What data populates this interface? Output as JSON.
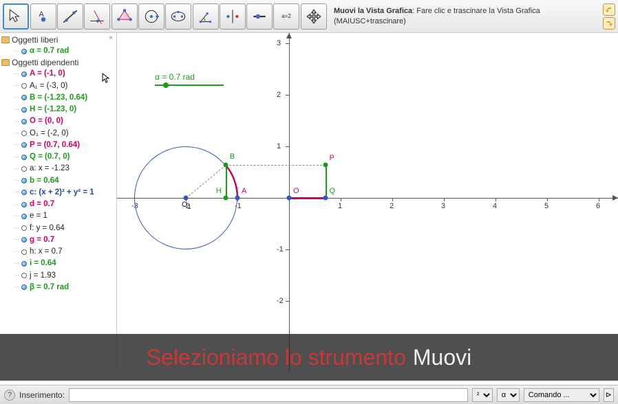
{
  "toolbar": {
    "hint_title": "Muovi la Vista Grafica",
    "hint_body": ": Fare clic e trascinare la Vista Grafica (MAIUSC+trascinare)",
    "tools": [
      "move",
      "point",
      "line",
      "perpendicular",
      "polygon",
      "circle",
      "ellipse",
      "angle",
      "reflect",
      "slider",
      "text",
      "move-view"
    ]
  },
  "sidebar": {
    "free_label": "Oggetti liberi",
    "dep_label": "Oggetti dipendenti",
    "free": [
      {
        "label": "α = 0.7 rad",
        "filled": true,
        "color": "#1a9c1a"
      }
    ],
    "dep": [
      {
        "label": "A = (-1, 0)",
        "filled": true,
        "color": "#cc0066"
      },
      {
        "label": "A₁ = (-3, 0)",
        "filled": false,
        "color": "#222"
      },
      {
        "label": "B = (-1.23, 0.64)",
        "filled": true,
        "color": "#1a9c1a"
      },
      {
        "label": "H = (-1.23, 0)",
        "filled": true,
        "color": "#1a9c1a"
      },
      {
        "label": "O = (0, 0)",
        "filled": true,
        "color": "#cc0066"
      },
      {
        "label": "O₁ = (-2, 0)",
        "filled": false,
        "color": "#222"
      },
      {
        "label": "P = (0.7, 0.64)",
        "filled": true,
        "color": "#cc0066"
      },
      {
        "label": "Q = (0.7, 0)",
        "filled": true,
        "color": "#1a9c1a"
      },
      {
        "label": "a: x = -1.23",
        "filled": false,
        "color": "#222"
      },
      {
        "label": "b = 0.64",
        "filled": true,
        "color": "#1a9c1a"
      },
      {
        "label": "c: (x + 2)² + y² = 1",
        "filled": true,
        "color": "#2244aa"
      },
      {
        "label": "d = 0.7",
        "filled": true,
        "color": "#cc0066"
      },
      {
        "label": "e = 1",
        "filled": true,
        "color": "#222"
      },
      {
        "label": "f: y = 0.64",
        "filled": false,
        "color": "#222"
      },
      {
        "label": "g = 0.7",
        "filled": true,
        "color": "#cc0066"
      },
      {
        "label": "h: x = 0.7",
        "filled": false,
        "color": "#222"
      },
      {
        "label": "i = 0.64",
        "filled": true,
        "color": "#1a9c1a"
      },
      {
        "label": "j = 1.93",
        "filled": false,
        "color": "#222"
      },
      {
        "label": "β = 0.7 rad",
        "filled": true,
        "color": "#1a9c1a"
      }
    ]
  },
  "graph": {
    "slider_label": "α = 0.7 rad",
    "x_ticks": [
      "-3",
      "-2",
      "-1",
      "1",
      "2",
      "3",
      "4",
      "5",
      "6"
    ],
    "y_ticks": [
      "-2",
      "-1",
      "1",
      "2",
      "3"
    ],
    "points": {
      "A": {
        "x": -1,
        "y": 0,
        "color": "#3355cc",
        "label_color": "#cc0066"
      },
      "B": {
        "x": -1.23,
        "y": 0.64,
        "color": "#1a9c1a",
        "label_color": "#1a9c1a"
      },
      "H": {
        "x": -1.23,
        "y": 0,
        "color": "#1a9c1a",
        "label_color": "#1a9c1a"
      },
      "O": {
        "x": 0,
        "y": 0,
        "color": "#3355cc",
        "label_color": "#cc0066"
      },
      "O1": {
        "x": -2,
        "y": 0,
        "color": "#3355cc",
        "label_color": "#222",
        "sub": "1"
      },
      "P": {
        "x": 0.7,
        "y": 0.64,
        "color": "#1a9c1a",
        "label_color": "#cc0066"
      },
      "Q": {
        "x": 0.7,
        "y": 0,
        "color": "#3355cc",
        "label_color": "#1a9c1a"
      }
    }
  },
  "overlay": {
    "red": "Selezioniamo lo strumento",
    "white": "Muovi"
  },
  "bottom": {
    "input_label": "Inserimento:",
    "sel1": "²",
    "sel2": "α",
    "sel3": "Comando ...",
    "btn": "⊳"
  }
}
